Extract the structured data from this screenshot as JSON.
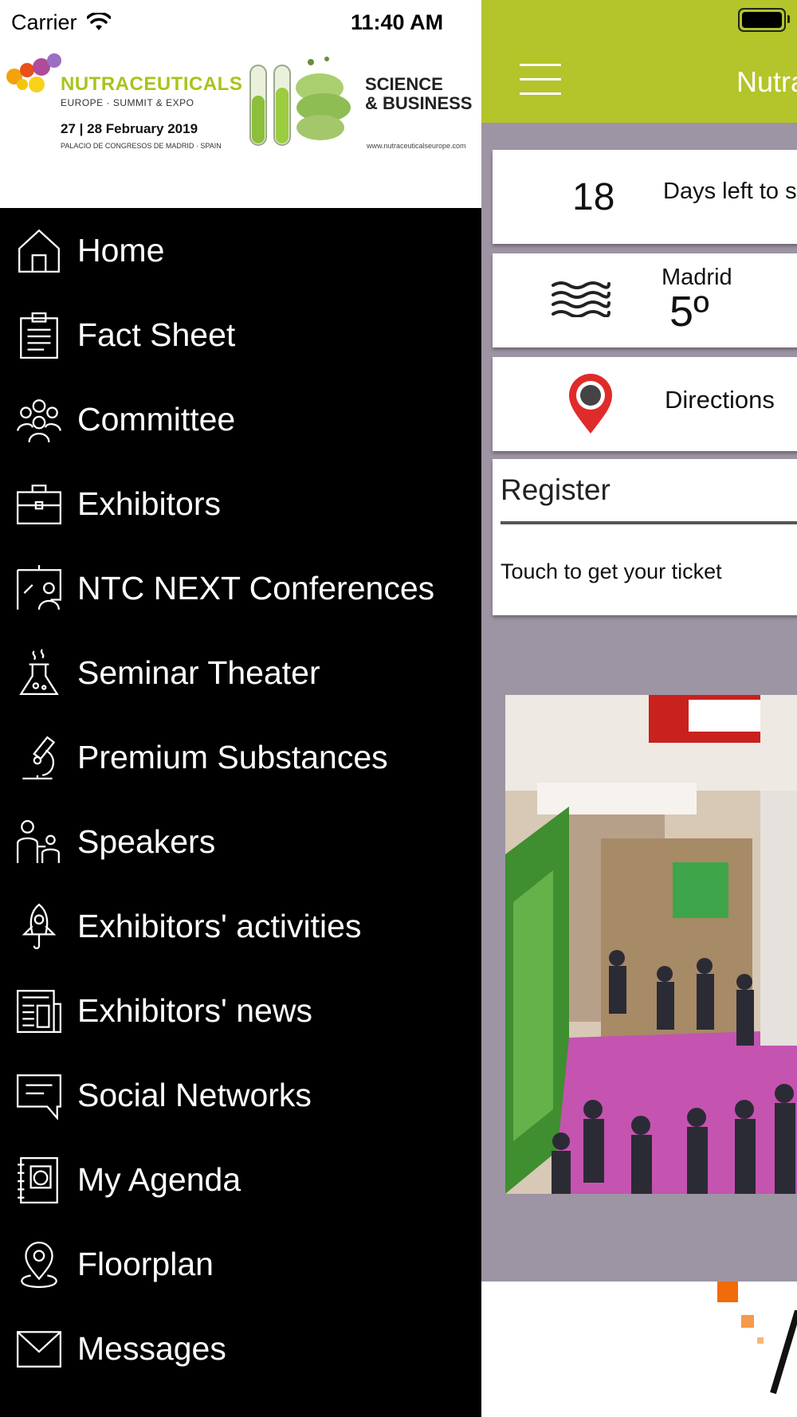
{
  "status_bar": {
    "carrier": "Carrier",
    "time": "11:40 AM"
  },
  "logo": {
    "brand": "NUTRACEUTICALS",
    "sub": "EUROPE · SUMMIT & EXPO",
    "date": "27 | 28 February 2019",
    "venue": "PALACIO DE CONGRESOS DE MADRID · SPAIN",
    "tagline_1": "SCIENCE",
    "tagline_2": "& BUSINESS",
    "url": "www.nutraceuticalseurope.com"
  },
  "menu": {
    "items": [
      {
        "label": "Home",
        "icon": "home-icon"
      },
      {
        "label": "Fact Sheet",
        "icon": "clipboard-icon"
      },
      {
        "label": "Committee",
        "icon": "group-icon"
      },
      {
        "label": "Exhibitors",
        "icon": "briefcase-icon"
      },
      {
        "label": "NTC NEXT Conferences",
        "icon": "presentation-icon"
      },
      {
        "label": "Seminar Theater",
        "icon": "flask-icon"
      },
      {
        "label": "Premium Substances",
        "icon": "microscope-icon"
      },
      {
        "label": "Speakers",
        "icon": "speakers-icon"
      },
      {
        "label": "Exhibitors' activities",
        "icon": "rocket-icon"
      },
      {
        "label": "Exhibitors' news",
        "icon": "newspaper-icon"
      },
      {
        "label": "Social Networks",
        "icon": "chat-icon"
      },
      {
        "label": "My Agenda",
        "icon": "agenda-icon"
      },
      {
        "label": "Floorplan",
        "icon": "map-pin-icon"
      },
      {
        "label": "Messages",
        "icon": "envelope-icon"
      }
    ]
  },
  "main": {
    "title": "Nutra",
    "days": {
      "value": "18",
      "text": "Days left to s"
    },
    "weather": {
      "city": "Madrid",
      "temp": "5º",
      "icon": "fog-icon"
    },
    "directions": {
      "label": "Directions",
      "icon": "location-pin-icon"
    },
    "register": {
      "title": "Register",
      "subtitle": "Touch to get your ticket"
    }
  },
  "colors": {
    "accent": "#b3c52a",
    "background": "#9d95a3",
    "drawer": "#000000",
    "pin": "#e02b2b"
  }
}
